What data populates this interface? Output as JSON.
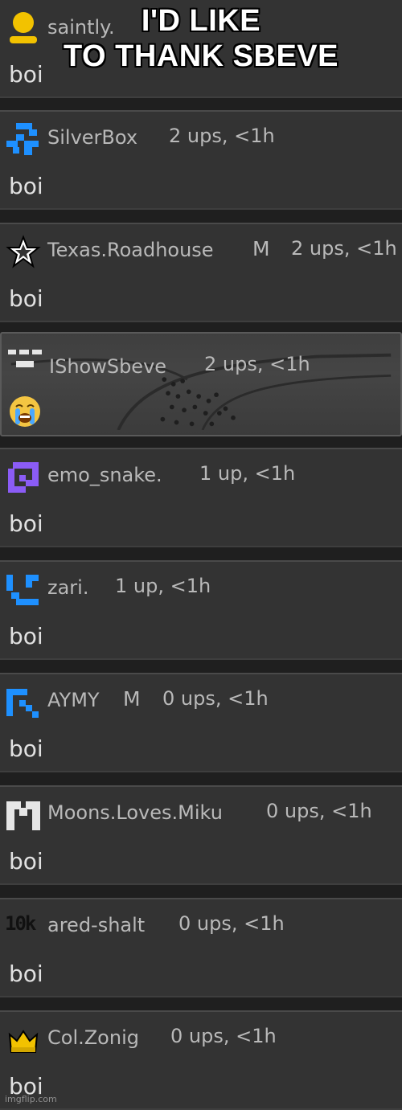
{
  "caption": {
    "line1": "I'D LIKE",
    "line2": "TO THANK SBEVE"
  },
  "comments": [
    {
      "username": "saintly.",
      "meta": "",
      "body": "boi",
      "mod": ""
    },
    {
      "username": "SilverBox",
      "meta": "2 ups, <1h",
      "body": "boi",
      "mod": ""
    },
    {
      "username": "Texas.Roadhouse",
      "meta": "2 ups, <1h",
      "body": "boi",
      "mod": "M"
    },
    {
      "username": "IShowSbeve",
      "meta": "2 ups, <1h",
      "body": "",
      "mod": ""
    },
    {
      "username": "emo_snake.",
      "meta": "1 up, <1h",
      "body": "boi",
      "mod": ""
    },
    {
      "username": "zari.",
      "meta": "1 up, <1h",
      "body": "boi",
      "mod": ""
    },
    {
      "username": "AYMY",
      "meta": "0 ups, <1h",
      "body": "boi",
      "mod": "M"
    },
    {
      "username": "Moons.Loves.Miku",
      "meta": "0 ups, <1h",
      "body": "boi",
      "mod": ""
    },
    {
      "username": "ared-shalt",
      "meta": "0 ups, <1h",
      "body": "boi",
      "mod": ""
    },
    {
      "username": "Col.Zonig",
      "meta": "0 ups, <1h",
      "body": "boi",
      "mod": ""
    }
  ],
  "avatar_badge_text": "10k",
  "watermark": "imgflip.com",
  "colors": {
    "panel": "#333333",
    "username": "#b9b9b9",
    "body": "#e1e1e1",
    "avatar_blue": "#1e90ff",
    "avatar_purple": "#8b5cf6",
    "avatar_yellow": "#f2c200"
  },
  "icons": [
    "yellow-person-icon",
    "blue-pixel-icon",
    "star-icon",
    "gray-pixel-icon",
    "purple-pixel-icon",
    "blue-pixel-icon",
    "blue-pixel-icon",
    "white-m-icon",
    "10k-icon",
    "crown-icon",
    "crying-face-emoji"
  ]
}
